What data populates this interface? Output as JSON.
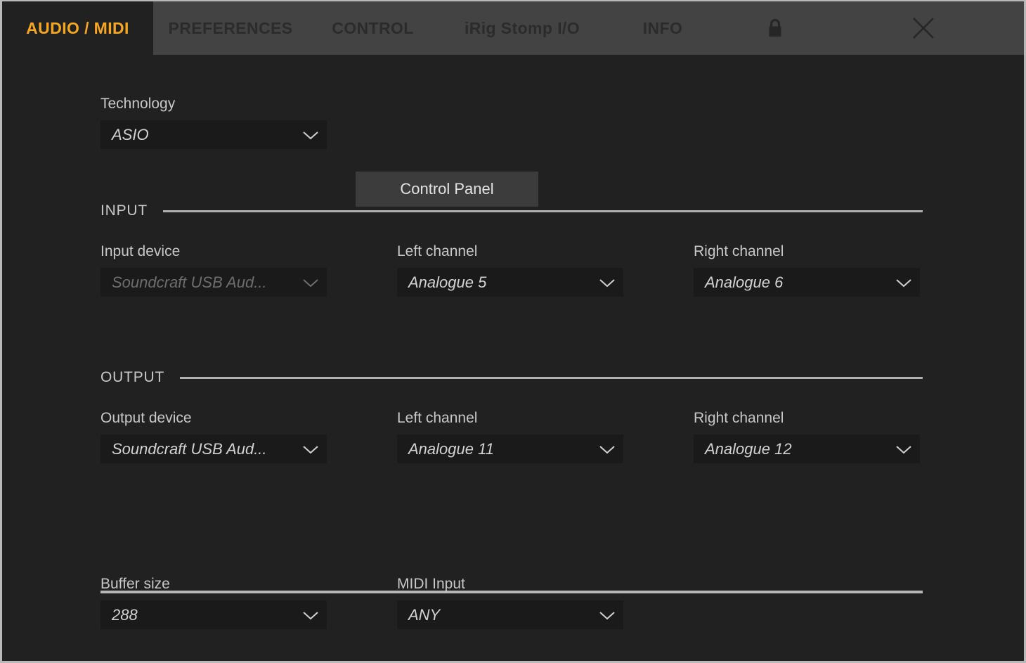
{
  "window": {
    "accent_color": "#f5a623",
    "background_color": "#212121",
    "tabbar_color": "#434343"
  },
  "tabs": [
    {
      "id": "audio-midi",
      "label": "AUDIO / MIDI",
      "active": true
    },
    {
      "id": "preferences",
      "label": "PREFERENCES",
      "active": false
    },
    {
      "id": "control",
      "label": "CONTROL",
      "active": false
    },
    {
      "id": "irig",
      "label": "iRig Stomp I/O",
      "active": false
    },
    {
      "id": "info",
      "label": "INFO",
      "active": false
    }
  ],
  "titlebar": {
    "lock_icon": "lock-icon",
    "close_icon": "close-icon"
  },
  "technology": {
    "label": "Technology",
    "value": "ASIO",
    "control_panel_label": "Control Panel"
  },
  "input_section": {
    "title": "INPUT",
    "device": {
      "label": "Input device",
      "value": "Soundcraft USB Aud...",
      "disabled": true
    },
    "left_channel": {
      "label": "Left channel",
      "value": "Analogue 5"
    },
    "right_channel": {
      "label": "Right channel",
      "value": "Analogue 6"
    }
  },
  "output_section": {
    "title": "OUTPUT",
    "device": {
      "label": "Output device",
      "value": "Soundcraft USB Aud...",
      "disabled": false
    },
    "left_channel": {
      "label": "Left channel",
      "value": "Analogue 11"
    },
    "right_channel": {
      "label": "Right channel",
      "value": "Analogue 12"
    }
  },
  "bottom_section": {
    "buffer_size": {
      "label": "Buffer size",
      "value": "288"
    },
    "midi_input": {
      "label": "MIDI Input",
      "value": "ANY"
    }
  }
}
